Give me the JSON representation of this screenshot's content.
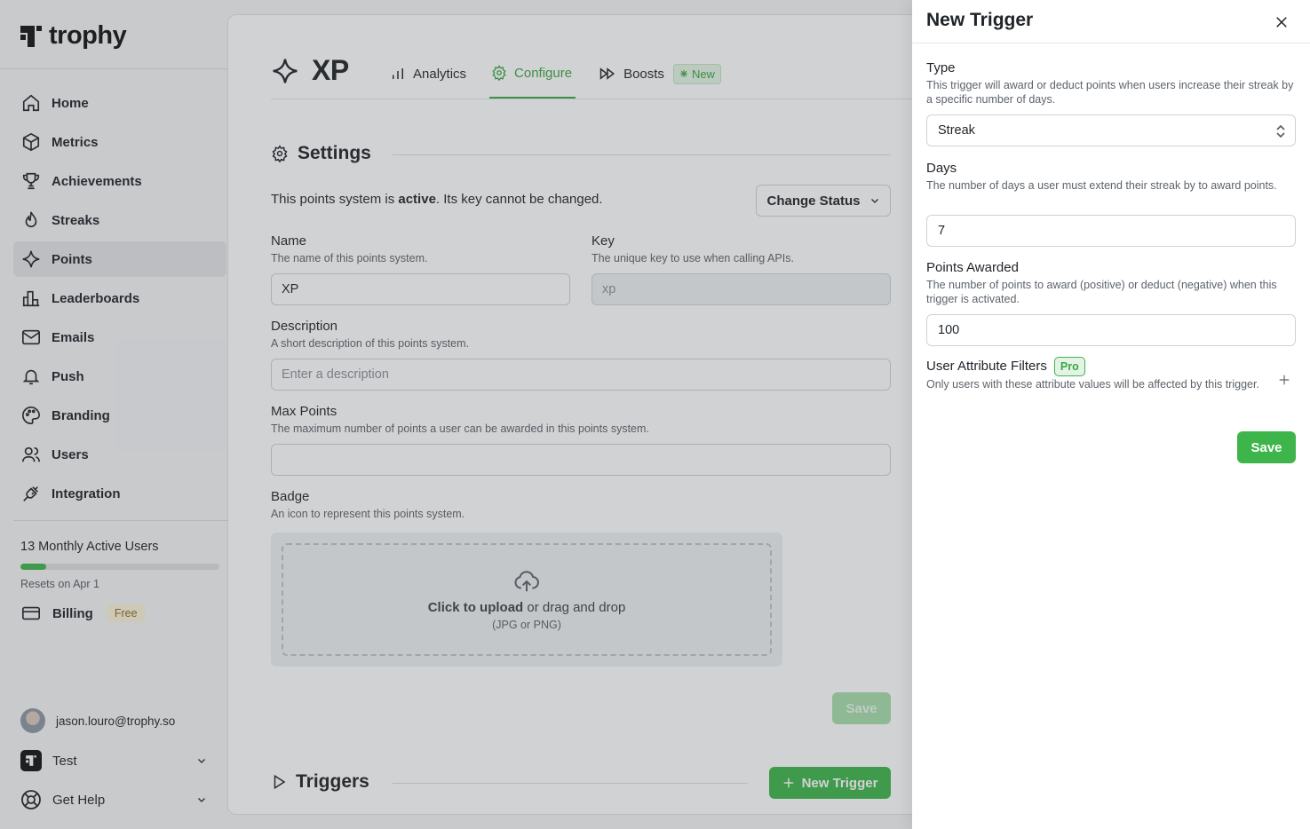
{
  "brand": {
    "name": "trophy",
    "accent": "#3db54a"
  },
  "sidebar": {
    "items": [
      {
        "label": "Home",
        "icon": "home-icon",
        "active": false
      },
      {
        "label": "Metrics",
        "icon": "cube-icon",
        "active": false
      },
      {
        "label": "Achievements",
        "icon": "trophy-icon",
        "active": false
      },
      {
        "label": "Streaks",
        "icon": "flame-icon",
        "active": false
      },
      {
        "label": "Points",
        "icon": "sparkle-icon",
        "active": true
      },
      {
        "label": "Leaderboards",
        "icon": "bar-chart-icon",
        "active": false
      },
      {
        "label": "Emails",
        "icon": "mail-icon",
        "active": false
      },
      {
        "label": "Push",
        "icon": "bell-icon",
        "active": false
      },
      {
        "label": "Branding",
        "icon": "palette-icon",
        "active": false
      },
      {
        "label": "Users",
        "icon": "users-icon",
        "active": false
      },
      {
        "label": "Integration",
        "icon": "plug-icon",
        "active": false
      }
    ],
    "mau_label": "13 Monthly Active Users",
    "mau_progress": 0.13,
    "mau_reset": "Resets on Apr 1",
    "billing_label": "Billing",
    "billing_badge": "Free",
    "user_email": "jason.louro@trophy.so",
    "team_label": "Test",
    "help_label": "Get Help"
  },
  "header": {
    "title": "XP",
    "tabs": [
      {
        "label": "Analytics",
        "active": false
      },
      {
        "label": "Configure",
        "active": true
      },
      {
        "label": "Boosts",
        "active": false,
        "badge": "New"
      }
    ]
  },
  "settings": {
    "title": "Settings",
    "status_prefix": "This points system is ",
    "status_value": "active",
    "status_suffix": ". Its key cannot be changed.",
    "change_status_label": "Change Status",
    "name_label": "Name",
    "name_help": "The name of this points system.",
    "name_value": "XP",
    "key_label": "Key",
    "key_help": "The unique key to use when calling APIs.",
    "key_value": "xp",
    "description_label": "Description",
    "description_help": "A short description of this points system.",
    "description_placeholder": "Enter a description",
    "max_points_label": "Max Points",
    "max_points_help": "The maximum number of points a user can be awarded in this points system.",
    "max_points_value": "",
    "badge_label": "Badge",
    "badge_help": "An icon to represent this points system.",
    "upload_strong": "Click to upload",
    "upload_rest": " or drag and drop",
    "upload_formats": "(JPG or PNG)",
    "save_label": "Save"
  },
  "triggers": {
    "title": "Triggers",
    "new_trigger_label": "New Trigger"
  },
  "drawer": {
    "title": "New Trigger",
    "type_label": "Type",
    "type_help": "This trigger will award or deduct points when users increase their streak by a specific number of days.",
    "type_value": "Streak",
    "days_label": "Days",
    "days_help": "The number of days a user must extend their streak by to award points.",
    "days_value": "7",
    "points_label": "Points Awarded",
    "points_help": "The number of points to award (positive) or deduct (negative) when this trigger is activated.",
    "points_value": "100",
    "filters_label": "User Attribute Filters",
    "filters_badge": "Pro",
    "filters_help": "Only users with these attribute values will be affected by this trigger.",
    "save_label": "Save"
  }
}
